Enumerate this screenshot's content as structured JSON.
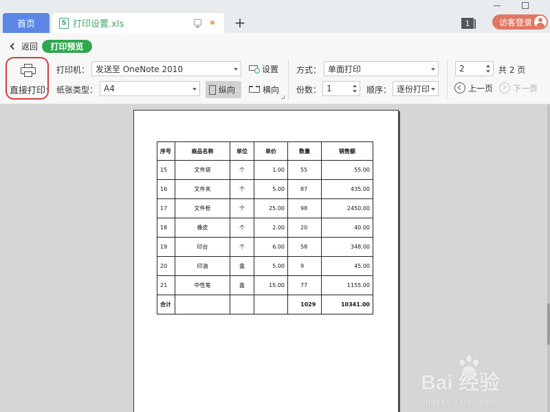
{
  "tabs": {
    "home_label": "首页",
    "doc_label": "打印设置.xls",
    "doc_icon_letter": "S",
    "add_label": "+",
    "page_badge": "1",
    "login_label": "访客登录"
  },
  "toolbar": {
    "back_label": "返回",
    "preview_label": "打印预览",
    "direct_print_label": "直接打印",
    "printer_label": "打印机：",
    "printer_value": "发送至 OneNote 2010",
    "settings_label": "设置",
    "paper_label": "纸张类型：",
    "paper_value": "A4",
    "portrait_label": "纵向",
    "landscape_label": "横向",
    "mode_label": "方式：",
    "mode_value": "单面打印",
    "copies_label": "份数：",
    "copies_value": "1",
    "order_label": "顺序：",
    "order_value": "逐份打印",
    "page_value": "2",
    "total_pages_label": "共 2 页",
    "prev_label": "上一页",
    "next_label": "下一页"
  },
  "sheet": {
    "headers": [
      "序号",
      "商品名称",
      "单位",
      "单价",
      "数量",
      "销售额"
    ],
    "rows": [
      [
        "15",
        "文件袋",
        "个",
        "1.00",
        "55",
        "55.00"
      ],
      [
        "16",
        "文件夹",
        "个",
        "5.00",
        "87",
        "435.00"
      ],
      [
        "17",
        "文件框",
        "个",
        "25.00",
        "98",
        "2450.00"
      ],
      [
        "18",
        "橡皮",
        "个",
        "2.00",
        "20",
        "40.00"
      ],
      [
        "19",
        "印台",
        "个",
        "6.00",
        "58",
        "348.00"
      ],
      [
        "20",
        "印油",
        "盒",
        "5.00",
        "9",
        "45.00"
      ],
      [
        "21",
        "中性笔",
        "盒",
        "15.00",
        "77",
        "1155.00"
      ]
    ],
    "total": [
      "合计",
      "",
      "",
      "",
      "1029",
      "10341.00"
    ]
  },
  "watermark": {
    "logo_text": "Bai  经验",
    "url_text": "jingyan.baidu.com"
  },
  "colors": {
    "home_tab": "#5b86e5",
    "accent_green": "#2fa84f",
    "login_button": "#e07763",
    "highlight_circle": "#d43a3a"
  }
}
